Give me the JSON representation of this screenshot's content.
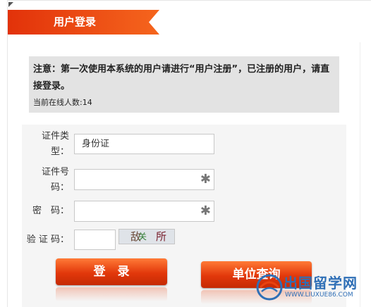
{
  "header": {
    "title": "用户登录"
  },
  "notice": {
    "text": "注意：第一次使用本系统的用户请进行“用户注册”，已注册的用户，请直接登录。",
    "online_label": "当前在线人数:",
    "online_count": "14"
  },
  "form": {
    "id_type_label_line1": "证件类",
    "id_type_label_line2": "型：",
    "id_type_value": "身份证",
    "id_number_label_line1": "证件号",
    "id_number_label_line2": "码：",
    "password_label": "密　码：",
    "captcha_label": "验 证 码：",
    "required_mark": "✱",
    "captcha_chars": [
      "敌",
      "关",
      "所"
    ]
  },
  "buttons": {
    "login": "登　录",
    "unit_query": "单位查询"
  },
  "watermark": {
    "site": "出国留学网",
    "url": "WWW.LIUXUE86.COM"
  },
  "colors": {
    "accent": "#e8420f",
    "notice_bg": "#e3e3e3",
    "watermark": "#2f6fb6"
  }
}
